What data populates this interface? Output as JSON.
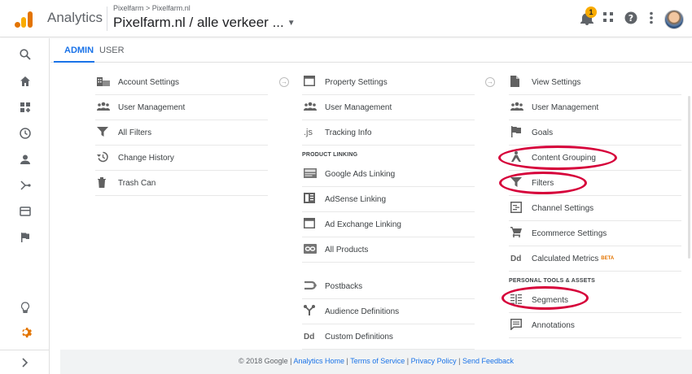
{
  "header": {
    "app_title": "Analytics",
    "breadcrumb": "Pixelfarm > Pixelfarm.nl",
    "view_name": "Pixelfarm.nl / alle verkeer ...",
    "notification_count": "1"
  },
  "tabs": [
    {
      "label": "ADMIN"
    },
    {
      "label": "USER"
    }
  ],
  "account_column": {
    "items": [
      {
        "label": "Account Settings",
        "icon": "building-icon"
      },
      {
        "label": "User Management",
        "icon": "people-icon"
      },
      {
        "label": "All Filters",
        "icon": "filter-icon"
      },
      {
        "label": "Change History",
        "icon": "history-icon"
      },
      {
        "label": "Trash Can",
        "icon": "trash-icon"
      }
    ]
  },
  "property_column": {
    "items": [
      {
        "label": "Property Settings",
        "icon": "window-icon"
      },
      {
        "label": "User Management",
        "icon": "people-icon"
      },
      {
        "label": "Tracking Info",
        "icon": "js-icon",
        "glyph": ".js"
      }
    ],
    "section_label": "PRODUCT LINKING",
    "linking": [
      {
        "label": "Google Ads Linking",
        "icon": "ads-icon"
      },
      {
        "label": "AdSense Linking",
        "icon": "adsense-icon"
      },
      {
        "label": "Ad Exchange Linking",
        "icon": "adexchange-icon"
      },
      {
        "label": "All Products",
        "icon": "link-icon"
      }
    ],
    "more": [
      {
        "label": "Postbacks",
        "icon": "postback-icon"
      },
      {
        "label": "Audience Definitions",
        "icon": "audience-icon"
      },
      {
        "label": "Custom Definitions",
        "icon": "custom-def-icon",
        "glyph": "Dd"
      }
    ]
  },
  "view_column": {
    "items": [
      {
        "label": "View Settings",
        "icon": "document-icon"
      },
      {
        "label": "User Management",
        "icon": "people-icon"
      },
      {
        "label": "Goals",
        "icon": "flag-icon"
      },
      {
        "label": "Content Grouping",
        "icon": "content-grouping-icon"
      },
      {
        "label": "Filters",
        "icon": "filter-icon"
      },
      {
        "label": "Channel Settings",
        "icon": "channel-icon"
      },
      {
        "label": "Ecommerce Settings",
        "icon": "cart-icon"
      },
      {
        "label": "Calculated Metrics",
        "icon": "calc-metric-icon",
        "glyph": "Dd",
        "badge": "BETA"
      }
    ],
    "section_label": "PERSONAL TOOLS & ASSETS",
    "personal": [
      {
        "label": "Segments",
        "icon": "segments-icon"
      },
      {
        "label": "Annotations",
        "icon": "annotation-icon"
      }
    ]
  },
  "footer": {
    "copyright": "© 2018 Google |",
    "links": [
      "Analytics Home",
      "Terms of Service",
      "Privacy Policy",
      "Send Feedback"
    ],
    "separator": "|"
  },
  "colors": {
    "accent": "#1a73e8",
    "brand_orange": "#e37400",
    "highlight": "#d6003a"
  }
}
